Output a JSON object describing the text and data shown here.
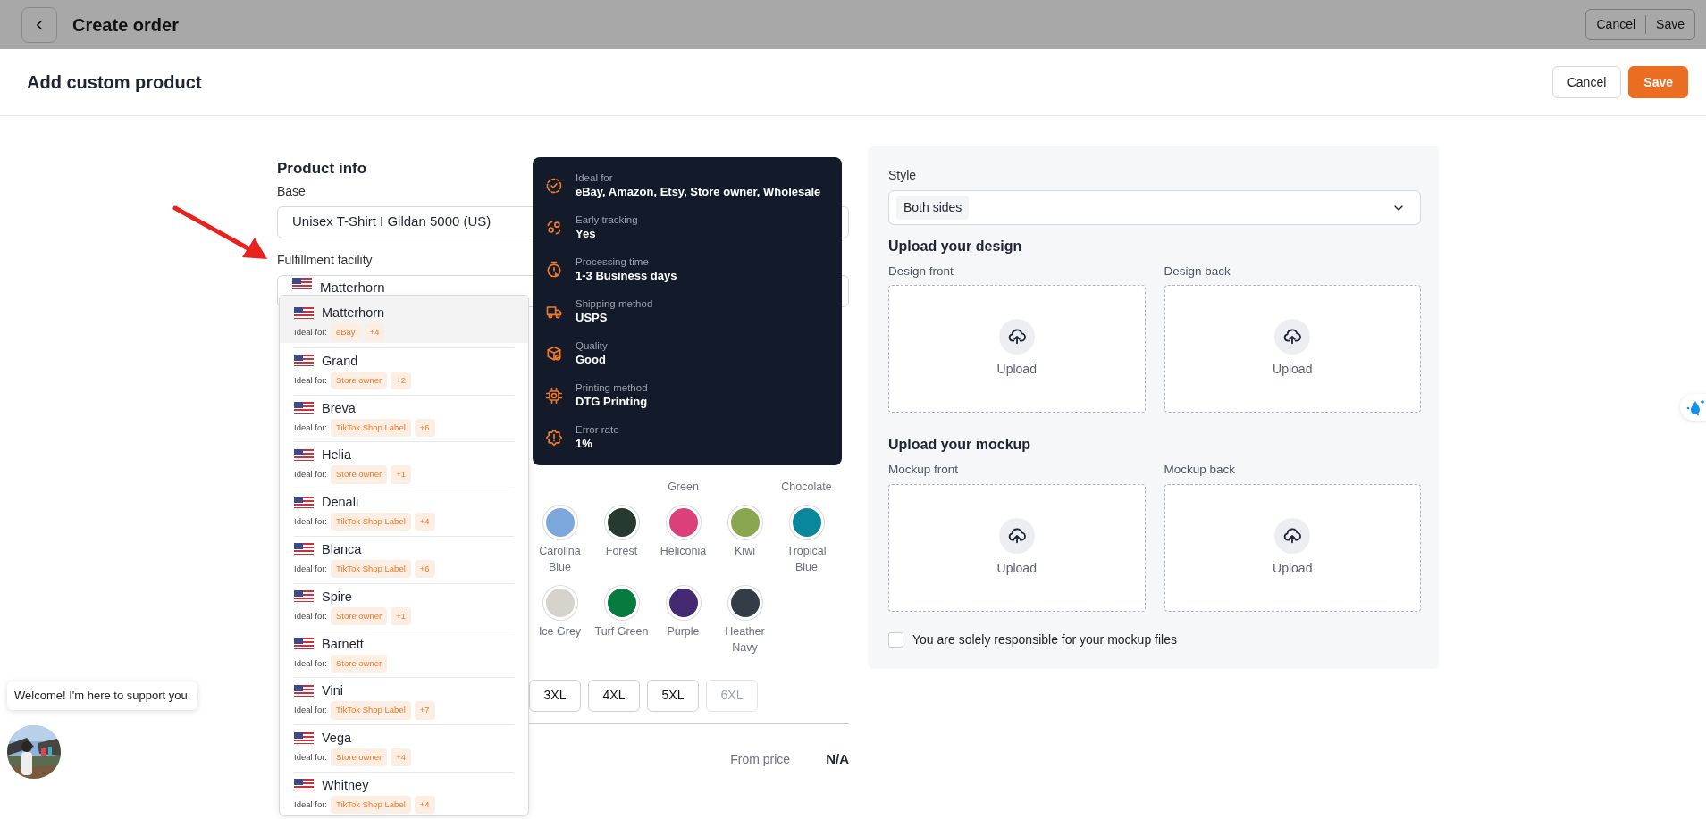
{
  "background_page": {
    "title": "Create order",
    "buttons": [
      "Cancel",
      "Save"
    ]
  },
  "modal": {
    "title": "Add custom product",
    "buttons": [
      {
        "label": "Cancel",
        "kind": "secondary"
      },
      {
        "label": "Save",
        "kind": "primary"
      }
    ]
  },
  "product_info": {
    "heading": "Product info",
    "base": {
      "label": "Base",
      "value": "Unisex T-Shirt I Gildan 5000 (US)"
    },
    "fulfillment": {
      "label": "Fulfillment facility",
      "value": "Matterhorn"
    }
  },
  "facility_options": [
    {
      "name": "Matterhorn",
      "ideal_label": "Ideal for:",
      "tags": [
        "eBay",
        "+4"
      ],
      "selected": true
    },
    {
      "name": "Grand",
      "ideal_label": "Ideal for:",
      "tags": [
        "Store owner",
        "+2"
      ],
      "selected": false
    },
    {
      "name": "Breva",
      "ideal_label": "Ideal for:",
      "tags": [
        "TikTok Shop Label",
        "+6"
      ],
      "selected": false
    },
    {
      "name": "Helia",
      "ideal_label": "Ideal for:",
      "tags": [
        "Store owner",
        "+1"
      ],
      "selected": false
    },
    {
      "name": "Denali",
      "ideal_label": "Ideal for:",
      "tags": [
        "TikTok Shop Label",
        "+4"
      ],
      "selected": false
    },
    {
      "name": "Blanca",
      "ideal_label": "Ideal for:",
      "tags": [
        "TikTok Shop Label",
        "+6"
      ],
      "selected": false
    },
    {
      "name": "Spire",
      "ideal_label": "Ideal for:",
      "tags": [
        "Store owner",
        "+1"
      ],
      "selected": false
    },
    {
      "name": "Barnett",
      "ideal_label": "Ideal for:",
      "tags": [
        "Store owner"
      ],
      "selected": false
    },
    {
      "name": "Vini",
      "ideal_label": "Ideal for:",
      "tags": [
        "TikTok Shop Label",
        "+7"
      ],
      "selected": false
    },
    {
      "name": "Vega",
      "ideal_label": "Ideal for:",
      "tags": [
        "Store owner",
        "+4"
      ],
      "selected": false
    },
    {
      "name": "Whitney",
      "ideal_label": "Ideal for:",
      "tags": [
        "TikTok Shop Label",
        "+4"
      ],
      "selected": false
    }
  ],
  "facility_tooltip": [
    {
      "kind": "check",
      "label": "Ideal for",
      "value": "eBay, Amazon, Etsy, Store owner, Wholesale"
    },
    {
      "kind": "tracking",
      "label": "Early tracking",
      "value": "Yes"
    },
    {
      "kind": "timer",
      "label": "Processing time",
      "value": "1-3 Business days"
    },
    {
      "kind": "truck",
      "label": "Shipping method",
      "value": "USPS"
    },
    {
      "kind": "box",
      "label": "Quality",
      "value": "Good"
    },
    {
      "kind": "chip",
      "label": "Printing method",
      "value": "DTG Printing"
    },
    {
      "kind": "alert",
      "label": "Error rate",
      "value": "1%"
    }
  ],
  "color_labels_above": [
    {
      "kind": "covered"
    },
    {
      "kind": "covered"
    },
    {
      "kind": "label",
      "text": "Green"
    },
    {
      "kind": "covered"
    },
    {
      "kind": "label",
      "text": "Chocolate"
    }
  ],
  "colors": [
    {
      "name": "Carolina Blue",
      "color": "#7ba7dc"
    },
    {
      "name": "Forest",
      "color": "#263a2f"
    },
    {
      "name": "Heliconia",
      "color": "#dd3f7a"
    },
    {
      "name": "Kiwi",
      "color": "#8aa64e"
    },
    {
      "name": "Tropical Blue",
      "color": "#0b879b"
    },
    {
      "name": "Ice Grey",
      "color": "#d6d3cd"
    },
    {
      "name": "Turf Green",
      "color": "#067a3f"
    },
    {
      "name": "Purple",
      "color": "#432a73"
    },
    {
      "name": "Heather Navy",
      "color": "#333d47"
    }
  ],
  "sizes": [
    {
      "label": "3XL",
      "disabled": false
    },
    {
      "label": "4XL",
      "disabled": false
    },
    {
      "label": "5XL",
      "disabled": false
    },
    {
      "label": "6XL",
      "disabled": true
    }
  ],
  "price": {
    "label": "From price",
    "value": "N/A"
  },
  "style": {
    "label": "Style",
    "value": "Both sides"
  },
  "upload_sections": [
    {
      "heading": "Upload your design",
      "slots": [
        {
          "label": "Design front",
          "action": "Upload"
        },
        {
          "label": "Design back",
          "action": "Upload"
        }
      ]
    },
    {
      "heading": "Upload your mockup",
      "slots": [
        {
          "label": "Mockup front",
          "action": "Upload"
        },
        {
          "label": "Mockup back",
          "action": "Upload"
        }
      ]
    }
  ],
  "responsibility": {
    "label": "You are solely responsible for your mockup files",
    "checked": false
  },
  "chat": {
    "message": "Welcome! I'm here to support you."
  }
}
